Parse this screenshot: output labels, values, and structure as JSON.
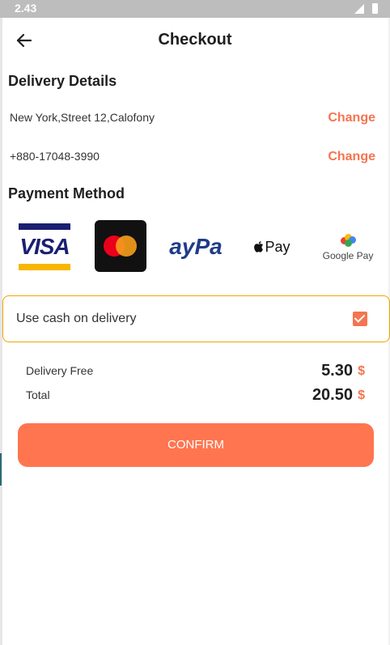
{
  "status_bar": {
    "time": "2.43"
  },
  "header": {
    "title": "Checkout"
  },
  "delivery": {
    "section_title": "Delivery Details",
    "address": "New York,Street 12,Calofony",
    "phone": "+880-17048-3990",
    "change_label": "Change"
  },
  "payment": {
    "section_title": "Payment Method",
    "methods": [
      {
        "name": "Visa",
        "label": "VISA",
        "icon": "visa-logo"
      },
      {
        "name": "Mastercard",
        "icon": "mastercard-logo"
      },
      {
        "name": "PayPal",
        "label": "ayPa",
        "icon": "paypal-logo"
      },
      {
        "name": "Apple Pay",
        "label": " Pay",
        "icon": "apple-pay-logo"
      },
      {
        "name": "Google Pay",
        "label": "Google Pay",
        "icon": "google-pay-logo"
      }
    ],
    "cash_option": {
      "label": "Use cash on delivery",
      "checked": true
    }
  },
  "summary": {
    "delivery_fee": {
      "label": "Delivery Free",
      "value": "5.30",
      "currency": "$"
    },
    "total": {
      "label": "Total",
      "value": "20.50",
      "currency": "$"
    }
  },
  "confirm_label": "CONFIRM",
  "colors": {
    "accent": "#ff7550",
    "border": "#f0a500",
    "text": "#1f1f1f"
  }
}
